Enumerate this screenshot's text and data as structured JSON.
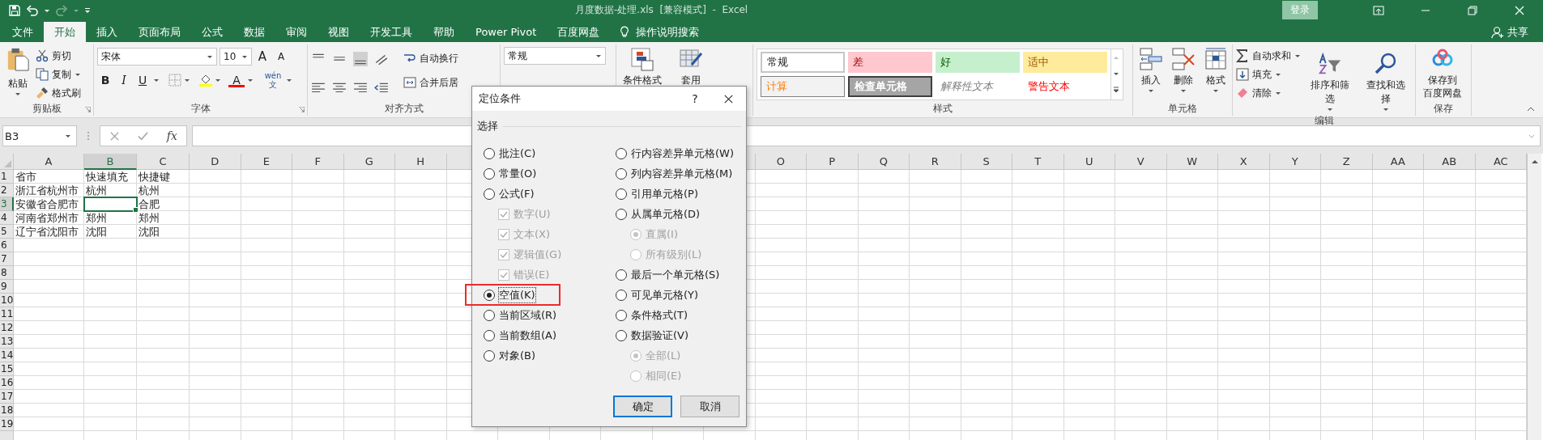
{
  "window": {
    "title": "月度数据-处理.xls  [兼容模式]  -  Excel",
    "sign_in": "登录"
  },
  "tabs": [
    {
      "label": "文件",
      "selected": false
    },
    {
      "label": "开始",
      "selected": true
    },
    {
      "label": "插入",
      "selected": false
    },
    {
      "label": "页面布局",
      "selected": false
    },
    {
      "label": "公式",
      "selected": false
    },
    {
      "label": "数据",
      "selected": false
    },
    {
      "label": "审阅",
      "selected": false
    },
    {
      "label": "视图",
      "selected": false
    },
    {
      "label": "开发工具",
      "selected": false
    },
    {
      "label": "帮助",
      "selected": false
    },
    {
      "label": "Power Pivot",
      "selected": false
    },
    {
      "label": "百度网盘",
      "selected": false
    }
  ],
  "tell_me": "操作说明搜索",
  "share": "共享",
  "ribbon": {
    "clipboard": {
      "paste": "粘贴",
      "cut": "剪切",
      "copy": "复制",
      "format_painter": "格式刷",
      "label": "剪贴板"
    },
    "font": {
      "font_name": "宋体",
      "font_size": "10",
      "grow": "A",
      "shrink": "A",
      "bold": "B",
      "italic": "I",
      "underline": "U",
      "font_color": "A",
      "phonetic": [
        "wén",
        "文"
      ],
      "label": "字体"
    },
    "alignment": {
      "wrap_text": "自动换行",
      "merge": "合并后居",
      "label": "对齐方式"
    },
    "number": {
      "format": "常规"
    },
    "conditional_format": "条件格式",
    "format_as_table": "套用",
    "styles": {
      "cells": [
        {
          "label": "常规",
          "kind": "normal"
        },
        {
          "label": "差",
          "kind": "bad"
        },
        {
          "label": "好",
          "kind": "good"
        },
        {
          "label": "适中",
          "kind": "neutral"
        },
        {
          "label": "计算",
          "kind": "calculation"
        },
        {
          "label": "检查单元格",
          "kind": "check"
        },
        {
          "label": "解释性文本",
          "kind": "explanatory"
        },
        {
          "label": "警告文本",
          "kind": "warning"
        }
      ],
      "label": "样式"
    },
    "cells": {
      "buttons": [
        "插入",
        "删除",
        "格式"
      ],
      "label": "单元格"
    },
    "editing": {
      "autosum": "自动求和",
      "fill": "填充",
      "clear": "清除",
      "sort_filter": "排序和筛选",
      "find_select": "查找和选择",
      "label": "编辑"
    },
    "save": {
      "lines": [
        "保存到",
        "百度网盘"
      ],
      "label": "保存"
    }
  },
  "formula_bar": {
    "name_box": "B3",
    "fx": "fx"
  },
  "sheet": {
    "columns_left": [
      {
        "label": "A",
        "selected": false
      },
      {
        "label": "B",
        "selected": true
      },
      {
        "label": "C",
        "selected": false
      },
      {
        "label": "D",
        "selected": false
      },
      {
        "label": "E",
        "selected": false
      },
      {
        "label": "F",
        "selected": false
      },
      {
        "label": "G",
        "selected": false
      },
      {
        "label": "H",
        "selected": false
      }
    ],
    "columns_right": [
      {
        "label": "O",
        "selected": false
      },
      {
        "label": "P",
        "selected": false
      },
      {
        "label": "Q",
        "selected": false
      },
      {
        "label": "R",
        "selected": false
      },
      {
        "label": "S",
        "selected": false
      },
      {
        "label": "T",
        "selected": false
      },
      {
        "label": "U",
        "selected": false
      },
      {
        "label": "V",
        "selected": false
      },
      {
        "label": "W",
        "selected": false
      },
      {
        "label": "X",
        "selected": false
      },
      {
        "label": "Y",
        "selected": false
      },
      {
        "label": "Z",
        "selected": false
      },
      {
        "label": "AA",
        "selected": false
      },
      {
        "label": "AB",
        "selected": false
      },
      {
        "label": "AC",
        "selected": false
      }
    ],
    "rows": [
      {
        "number": "1",
        "selected": false,
        "cells": [
          {
            "text": "省市",
            "selected": false
          },
          {
            "text": "快速填充",
            "selected": false
          },
          {
            "text": "快捷键",
            "selected": false
          }
        ]
      },
      {
        "number": "2",
        "selected": false,
        "cells": [
          {
            "text": "浙江省杭州市",
            "selected": false
          },
          {
            "text": "杭州",
            "selected": false
          },
          {
            "text": "杭州",
            "selected": false
          }
        ]
      },
      {
        "number": "3",
        "selected": true,
        "cells": [
          {
            "text": "安徽省合肥市",
            "selected": false
          },
          {
            "selected": true
          },
          {
            "text": "合肥",
            "selected": false
          }
        ]
      },
      {
        "number": "4",
        "selected": false,
        "cells": [
          {
            "text": "河南省郑州市",
            "selected": false
          },
          {
            "text": "郑州",
            "selected": false
          },
          {
            "text": "郑州",
            "selected": false
          }
        ]
      },
      {
        "number": "5",
        "selected": false,
        "cells": [
          {
            "text": "辽宁省沈阳市",
            "selected": false
          },
          {
            "text": "沈阳",
            "selected": false
          },
          {
            "text": "沈阳",
            "selected": false
          }
        ]
      },
      {
        "number": "6",
        "selected": false
      },
      {
        "number": "7",
        "selected": false
      },
      {
        "number": "8",
        "selected": false
      },
      {
        "number": "9",
        "selected": false
      },
      {
        "number": "10",
        "selected": false
      },
      {
        "number": "11",
        "selected": false
      },
      {
        "number": "12",
        "selected": false
      },
      {
        "number": "13",
        "selected": false
      },
      {
        "number": "14",
        "selected": false
      },
      {
        "number": "15",
        "selected": false
      },
      {
        "number": "16",
        "selected": false
      },
      {
        "number": "17",
        "selected": false
      },
      {
        "number": "18",
        "selected": false
      },
      {
        "number": "19",
        "selected": false
      }
    ]
  },
  "dialog": {
    "title": "定位条件",
    "help": "?",
    "section": "选择",
    "left_options": [
      {
        "label": "批注(C)",
        "kind": "radio",
        "selected": false,
        "disabled": false,
        "focused": false,
        "highlighted": false
      },
      {
        "label": "常量(O)",
        "kind": "radio",
        "selected": false,
        "disabled": false,
        "focused": false,
        "highlighted": false
      },
      {
        "label": "公式(F)",
        "kind": "radio",
        "selected": false,
        "disabled": false,
        "focused": false,
        "highlighted": false,
        "children": [
          {
            "label": "数字(U)",
            "kind": "checkbox",
            "checked": true,
            "disabled": true
          },
          {
            "label": "文本(X)",
            "kind": "checkbox",
            "checked": true,
            "disabled": true
          },
          {
            "label": "逻辑值(G)",
            "kind": "checkbox",
            "checked": true,
            "disabled": true
          },
          {
            "label": "错误(E)",
            "kind": "checkbox",
            "checked": true,
            "disabled": true
          }
        ]
      },
      {
        "label": "空值(K)",
        "kind": "radio",
        "selected": true,
        "disabled": false,
        "focused": true,
        "highlighted": true
      },
      {
        "label": "当前区域(R)",
        "kind": "radio",
        "selected": false,
        "disabled": false,
        "focused": false,
        "highlighted": false
      },
      {
        "label": "当前数组(A)",
        "kind": "radio",
        "selected": false,
        "disabled": false,
        "focused": false,
        "highlighted": false
      },
      {
        "label": "对象(B)",
        "kind": "radio",
        "selected": false,
        "disabled": false,
        "focused": false,
        "highlighted": false
      }
    ],
    "right_options": [
      {
        "label": "行内容差异单元格(W)",
        "kind": "radio",
        "selected": false,
        "disabled": false,
        "focused": false,
        "highlighted": false
      },
      {
        "label": "列内容差异单元格(M)",
        "kind": "radio",
        "selected": false,
        "disabled": false,
        "focused": false,
        "highlighted": false
      },
      {
        "label": "引用单元格(P)",
        "kind": "radio",
        "selected": false,
        "disabled": false,
        "focused": false,
        "highlighted": false
      },
      {
        "label": "从属单元格(D)",
        "kind": "radio",
        "selected": false,
        "disabled": false,
        "focused": false,
        "highlighted": false,
        "children": [
          {
            "label": "直属(I)",
            "kind": "radio",
            "selected": true,
            "disabled": true
          },
          {
            "label": "所有级别(L)",
            "kind": "radio",
            "selected": false,
            "disabled": true
          }
        ]
      },
      {
        "label": "最后一个单元格(S)",
        "kind": "radio",
        "selected": false,
        "disabled": false,
        "focused": false,
        "highlighted": false
      },
      {
        "label": "可见单元格(Y)",
        "kind": "radio",
        "selected": false,
        "disabled": false,
        "focused": false,
        "highlighted": false
      },
      {
        "label": "条件格式(T)",
        "kind": "radio",
        "selected": false,
        "disabled": false,
        "focused": false,
        "highlighted": false
      },
      {
        "label": "数据验证(V)",
        "kind": "radio",
        "selected": false,
        "disabled": false,
        "focused": false,
        "highlighted": false,
        "children": [
          {
            "label": "全部(L)",
            "kind": "radio",
            "selected": true,
            "disabled": true
          },
          {
            "label": "相同(E)",
            "kind": "radio",
            "selected": false,
            "disabled": true
          }
        ]
      }
    ],
    "buttons": [
      {
        "label": "确定",
        "default": true
      },
      {
        "label": "取消",
        "default": false
      }
    ]
  }
}
